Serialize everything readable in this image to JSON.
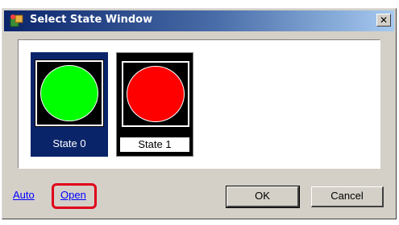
{
  "window": {
    "title": "Select State Window",
    "close_symbol": "✕",
    "title_icon": "app-icon"
  },
  "states": [
    {
      "label": "State 0",
      "color": "#00ff00",
      "selected": true
    },
    {
      "label": "State 1",
      "color": "#ff0000",
      "selected": false
    }
  ],
  "links": {
    "auto": "Auto",
    "open": "Open"
  },
  "buttons": {
    "ok": "OK",
    "cancel": "Cancel"
  },
  "colors": {
    "selection": "#0a246a",
    "highlight": "#e0001a",
    "link": "#0000ff"
  }
}
